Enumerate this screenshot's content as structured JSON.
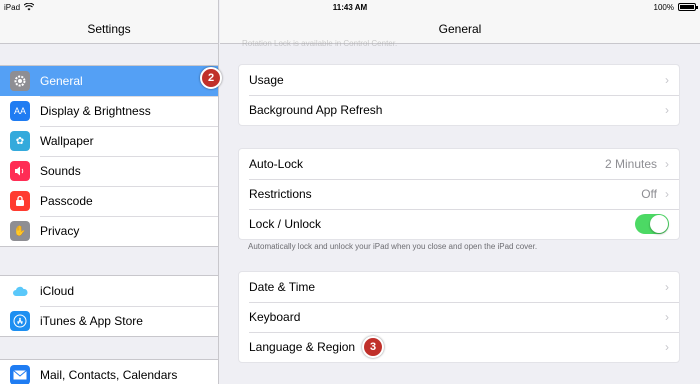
{
  "status_bar": {
    "device": "iPad",
    "time": "11:43 AM",
    "battery": "100%"
  },
  "sidebar": {
    "title": "Settings",
    "groups": [
      {
        "items": [
          {
            "label": "General",
            "icon": "gear-icon",
            "color": "#8e8e93",
            "selected": true
          },
          {
            "label": "Display & Brightness",
            "icon": "aa-icon",
            "color": "#1f7cf2"
          },
          {
            "label": "Wallpaper",
            "icon": "flower-icon",
            "color": "#34aadc"
          },
          {
            "label": "Sounds",
            "icon": "speaker-icon",
            "color": "#ff2d55"
          },
          {
            "label": "Passcode",
            "icon": "lock-icon",
            "color": "#ff3b30"
          },
          {
            "label": "Privacy",
            "icon": "hand-icon",
            "color": "#8e8e93"
          }
        ]
      },
      {
        "items": [
          {
            "label": "iCloud",
            "icon": "cloud-icon",
            "color": "#ffffff"
          },
          {
            "label": "iTunes & App Store",
            "icon": "app-store-icon",
            "color": "#1d8ff1"
          }
        ]
      },
      {
        "items": [
          {
            "label": "Mail, Contacts, Calendars",
            "icon": "mail-icon",
            "color": "#1f7cf2"
          }
        ]
      }
    ]
  },
  "annotations": {
    "badge_2": "2",
    "badge_3": "3"
  },
  "main": {
    "title": "General",
    "faded_note": "Rotation Lock is available in Control Center.",
    "section1": {
      "usage": "Usage",
      "background_refresh": "Background App Refresh"
    },
    "section2": {
      "auto_lock": "Auto-Lock",
      "auto_lock_value": "2 Minutes",
      "restrictions": "Restrictions",
      "restrictions_value": "Off",
      "lock_unlock": "Lock / Unlock",
      "lock_unlock_on": true
    },
    "section2_footer": "Automatically lock and unlock your iPad when you close and open the iPad cover.",
    "section3": {
      "date_time": "Date & Time",
      "keyboard": "Keyboard",
      "language_region": "Language & Region"
    },
    "accent_color": "#4cd964"
  }
}
